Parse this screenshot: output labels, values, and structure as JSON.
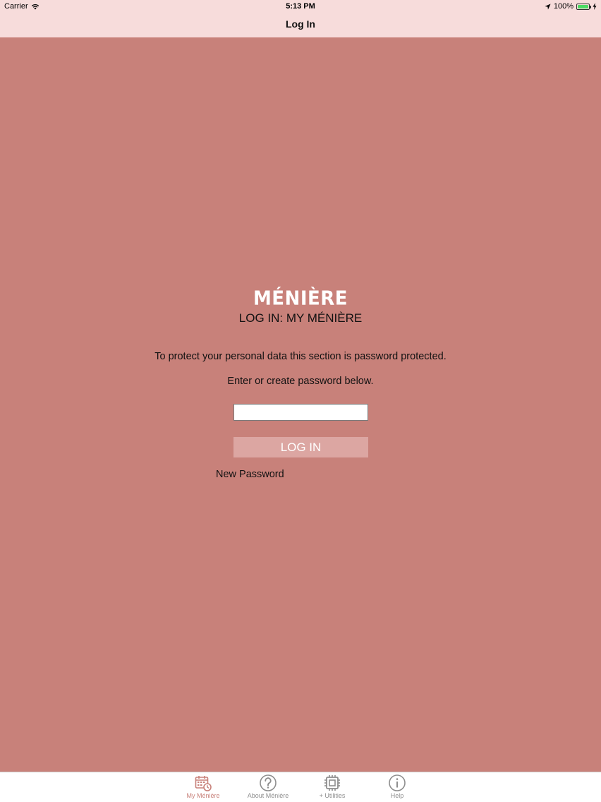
{
  "status_bar": {
    "carrier": "Carrier",
    "time": "5:13 PM",
    "battery_percent": "100%",
    "battery_level": 1.0
  },
  "nav": {
    "title": "Log In"
  },
  "main": {
    "logo_text": "MÉNIÈRE",
    "heading": "LOG IN: MY MÉNIÈRE",
    "info_line_1": "To protect your personal data this section is password protected.",
    "info_line_2": "Enter or create password below.",
    "password_value": "",
    "password_placeholder": "",
    "login_button_label": "LOG IN",
    "new_password_label": "New Password"
  },
  "tab_bar": {
    "items": [
      {
        "label": "My Ménière",
        "icon": "calendar-clock-icon",
        "active": true
      },
      {
        "label": "About Ménière",
        "icon": "question-circle-icon",
        "active": false
      },
      {
        "label": "+ Utilities",
        "icon": "chip-icon",
        "active": false
      },
      {
        "label": "Help",
        "icon": "info-circle-icon",
        "active": false
      }
    ]
  },
  "colors": {
    "background": "#c8817a",
    "nav_bar": "#f7dcdb",
    "button": "#dca6a2",
    "active_tab": "#c8817a",
    "inactive_tab": "#8e8e8e",
    "battery": "#4cd964"
  }
}
